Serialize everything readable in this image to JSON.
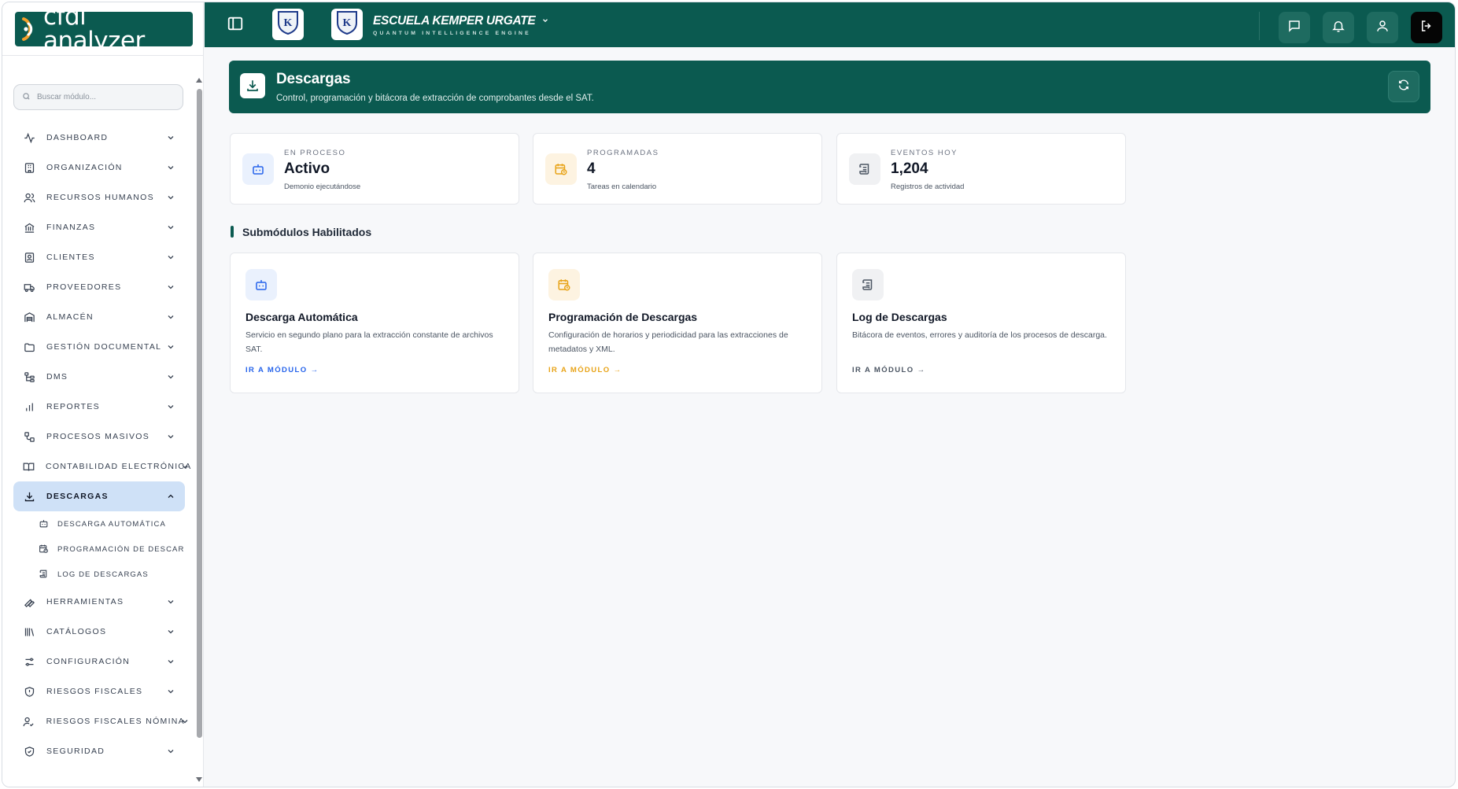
{
  "app": {
    "logo_text": "cfdi analyzer",
    "search_placeholder": "Buscar módulo..."
  },
  "sidebar": {
    "items": [
      {
        "label": "DASHBOARD",
        "icon": "activity-icon"
      },
      {
        "label": "ORGANIZACIÓN",
        "icon": "building-icon"
      },
      {
        "label": "RECURSOS HUMANOS",
        "icon": "users-icon"
      },
      {
        "label": "FINANZAS",
        "icon": "bank-icon"
      },
      {
        "label": "CLIENTES",
        "icon": "contact-icon"
      },
      {
        "label": "PROVEEDORES",
        "icon": "truck-icon"
      },
      {
        "label": "ALMACÉN",
        "icon": "warehouse-icon"
      },
      {
        "label": "GESTIÓN DOCUMENTAL",
        "icon": "folder-icon"
      },
      {
        "label": "DMS",
        "icon": "tree-icon"
      },
      {
        "label": "REPORTES",
        "icon": "bar-chart-icon"
      },
      {
        "label": "PROCESOS MASIVOS",
        "icon": "workflow-icon"
      },
      {
        "label": "CONTABILIDAD ELECTRÓNICA",
        "icon": "book-icon"
      },
      {
        "label": "DESCARGAS",
        "icon": "download-icon",
        "active": true
      },
      {
        "label": "HERRAMIENTAS",
        "icon": "wrench-icon"
      },
      {
        "label": "CATÁLOGOS",
        "icon": "library-icon"
      },
      {
        "label": "CONFIGURACIÓN",
        "icon": "settings-icon"
      },
      {
        "label": "RIESGOS FISCALES",
        "icon": "shield-alert-icon"
      },
      {
        "label": "RIESGOS FISCALES NÓMINA",
        "icon": "user-check-icon"
      },
      {
        "label": "SEGURIDAD",
        "icon": "shield-check-icon"
      }
    ],
    "subitems": [
      {
        "label": "DESCARGA AUTOMÁTICA",
        "icon": "bot-icon"
      },
      {
        "label": "PROGRAMACIÓN DE DESCARGAS",
        "icon": "calendar-clock-icon"
      },
      {
        "label": "LOG DE DESCARGAS",
        "icon": "scroll-icon"
      }
    ]
  },
  "topbar": {
    "school_name": "ESCUELA KEMPER URGATE",
    "school_subtitle": "QUANTUM INTELLIGENCE ENGINE",
    "crest_letter": "K"
  },
  "header": {
    "title": "Descargas",
    "subtitle": "Control, programación y bitácora de extracción de comprobantes desde el SAT."
  },
  "stats": [
    {
      "key": "EN PROCESO",
      "value": "Activo",
      "desc": "Demonio ejecutándose",
      "icon": "bot-icon"
    },
    {
      "key": "PROGRAMADAS",
      "value": "4",
      "desc": "Tareas en calendario",
      "icon": "calendar-clock-icon"
    },
    {
      "key": "EVENTOS HOY",
      "value": "1,204",
      "desc": "Registros de actividad",
      "icon": "scroll-icon"
    }
  ],
  "section_title": "Submódulos Habilitados",
  "modules": [
    {
      "title": "Descarga Automática",
      "desc": "Servicio en segundo plano para la extracción constante de archivos SAT.",
      "link": "IR A MÓDULO",
      "icon": "bot-icon",
      "accent": "#2563eb"
    },
    {
      "title": "Programación de Descargas",
      "desc": "Configuración de horarios y periodicidad para las extracciones de metadatos y XML.",
      "link": "IR A MÓDULO",
      "icon": "calendar-clock-icon",
      "accent": "#e8a317"
    },
    {
      "title": "Log de Descargas",
      "desc": "Bitácora de eventos, errores y auditoría de los procesos de descarga.",
      "link": "IR A MÓDULO",
      "icon": "scroll-icon",
      "accent": "#4b5563"
    }
  ],
  "colors": {
    "brand": "#0b5a50",
    "active_nav": "#cfe1f7",
    "blue": "#2563eb",
    "amber": "#e8a317",
    "gray": "#4b5563"
  }
}
